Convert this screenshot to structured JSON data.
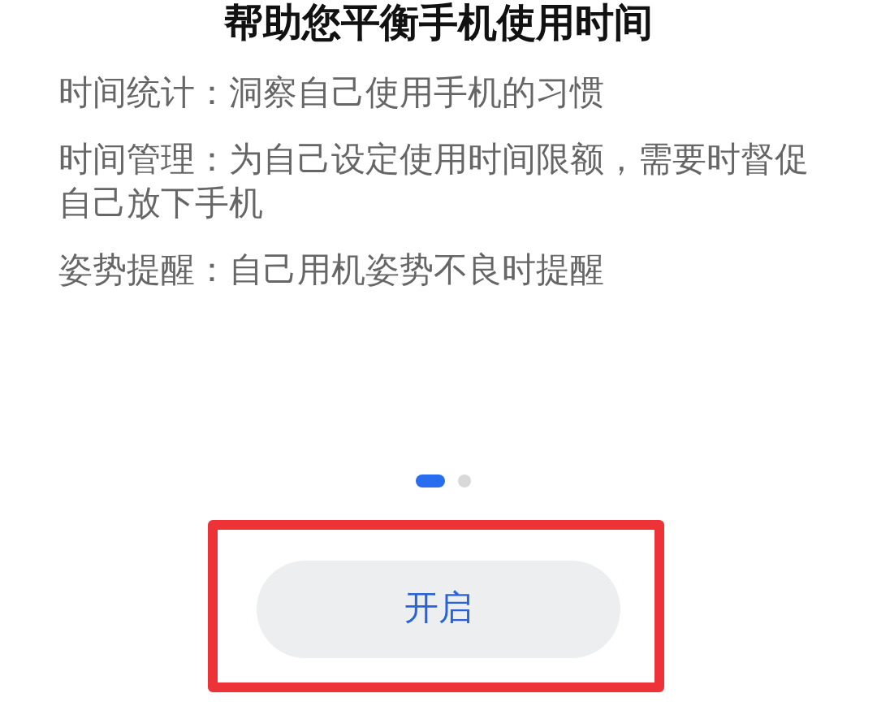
{
  "title": "帮助您平衡手机使用时间",
  "features": [
    "时间统计：洞察自己使用手机的习惯",
    "时间管理：为自己设定使用时间限额，需要时督促自己放下手机",
    "姿势提醒：自己用机姿势不良时提醒"
  ],
  "page_indicator": [
    {
      "selected": true
    },
    {
      "selected": false
    }
  ],
  "button": {
    "label": "开启"
  },
  "annotation_box": {
    "shown": true
  }
}
